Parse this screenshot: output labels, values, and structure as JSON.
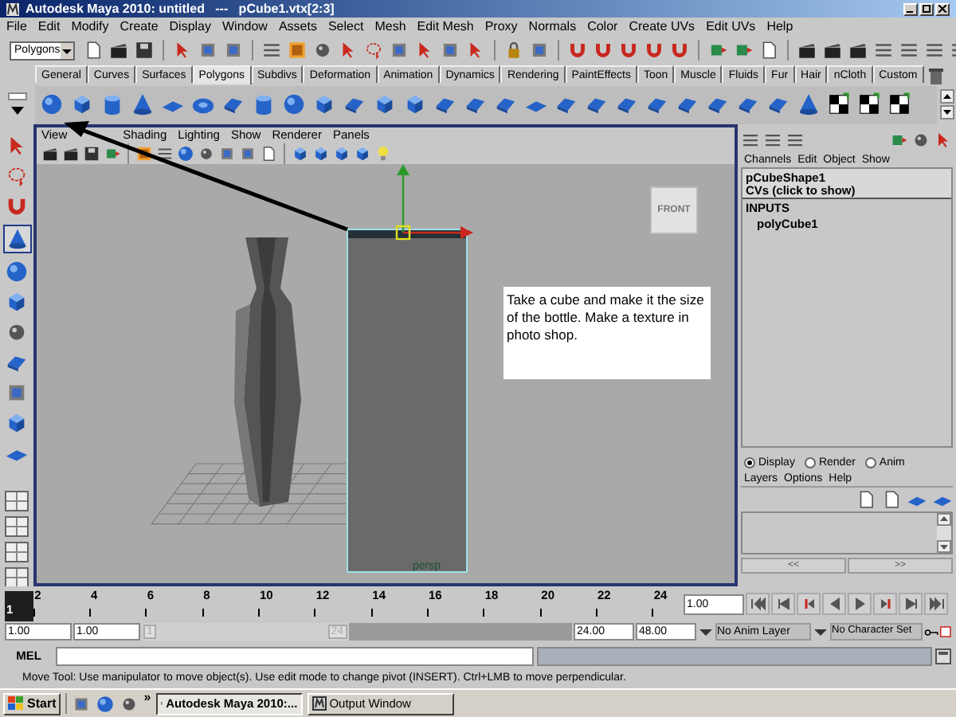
{
  "window": {
    "title": "Autodesk Maya 2010: untitled   ---   pCube1.vtx[2:3]"
  },
  "menu_bar": [
    "File",
    "Edit",
    "Modify",
    "Create",
    "Display",
    "Window",
    "Assets",
    "Select",
    "Mesh",
    "Edit Mesh",
    "Proxy",
    "Normals",
    "Color",
    "Create UVs",
    "Edit UVs",
    "Help"
  ],
  "status_line": {
    "menu_set": "Polygons"
  },
  "shelf_tabs": [
    {
      "label": "General",
      "selected": false
    },
    {
      "label": "Curves",
      "selected": false
    },
    {
      "label": "Surfaces",
      "selected": false
    },
    {
      "label": "Polygons",
      "selected": true
    },
    {
      "label": "Subdivs",
      "selected": false
    },
    {
      "label": "Deformation",
      "selected": false
    },
    {
      "label": "Animation",
      "selected": false
    },
    {
      "label": "Dynamics",
      "selected": false
    },
    {
      "label": "Rendering",
      "selected": false
    },
    {
      "label": "PaintEffects",
      "selected": false
    },
    {
      "label": "Toon",
      "selected": false
    },
    {
      "label": "Muscle",
      "selected": false
    },
    {
      "label": "Fluids",
      "selected": false
    },
    {
      "label": "Fur",
      "selected": false
    },
    {
      "label": "Hair",
      "selected": false
    },
    {
      "label": "nCloth",
      "selected": false
    },
    {
      "label": "Custom",
      "selected": false
    }
  ],
  "viewport": {
    "menus": [
      "View",
      "Shading",
      "Lighting",
      "Show",
      "Renderer",
      "Panels"
    ],
    "view_cube": "FRONT",
    "camera": "persp",
    "note": "Take a cube and make it the size of the bottle. Make a texture in  photo shop."
  },
  "channel_box": {
    "menus": [
      "Channels",
      "Edit",
      "Object",
      "Show"
    ],
    "object": "pCubeShape1",
    "cvs": "CVs (click to show)",
    "inputs_header": "INPUTS",
    "inputs": [
      "polyCube1"
    ]
  },
  "layer_editor": {
    "modes": [
      {
        "label": "Display",
        "selected": true
      },
      {
        "label": "Render",
        "selected": false
      },
      {
        "label": "Anim",
        "selected": false
      }
    ],
    "menus": [
      "Layers",
      "Options",
      "Help"
    ],
    "scroll_left": "<<",
    "scroll_right": ">>"
  },
  "time_slider": {
    "ticks": [
      {
        "label": "1",
        "selected": true
      },
      {
        "label": "2",
        "selected": false
      },
      {
        "label": "4",
        "selected": false
      },
      {
        "label": "6",
        "selected": false
      },
      {
        "label": "8",
        "selected": false
      },
      {
        "label": "10",
        "selected": false
      },
      {
        "label": "12",
        "selected": false
      },
      {
        "label": "14",
        "selected": false
      },
      {
        "label": "16",
        "selected": false
      },
      {
        "label": "18",
        "selected": false
      },
      {
        "label": "20",
        "selected": false
      },
      {
        "label": "22",
        "selected": false
      },
      {
        "label": "24",
        "selected": false
      }
    ],
    "current_frame": "1.00"
  },
  "range_slider": {
    "level": 0.48,
    "start": "1.00",
    "playback_start": "1.00",
    "range_start_label": "1",
    "range_end_label": "24",
    "playback_end": "24.00",
    "end": "48.00",
    "anim_layer": "No Anim Layer",
    "character_set": "No Character Set"
  },
  "command_line": {
    "label": "MEL"
  },
  "help_line": "Move Tool: Use manipulator to move object(s). Use edit mode to change pivot (INSERT).  Ctrl+LMB to move perpendicular.",
  "taskbar": {
    "start": "Start",
    "overflow": "»",
    "tasks": [
      {
        "label": "Autodesk Maya 2010:...",
        "selected": true
      },
      {
        "label": "Output Window",
        "selected": false
      }
    ]
  }
}
